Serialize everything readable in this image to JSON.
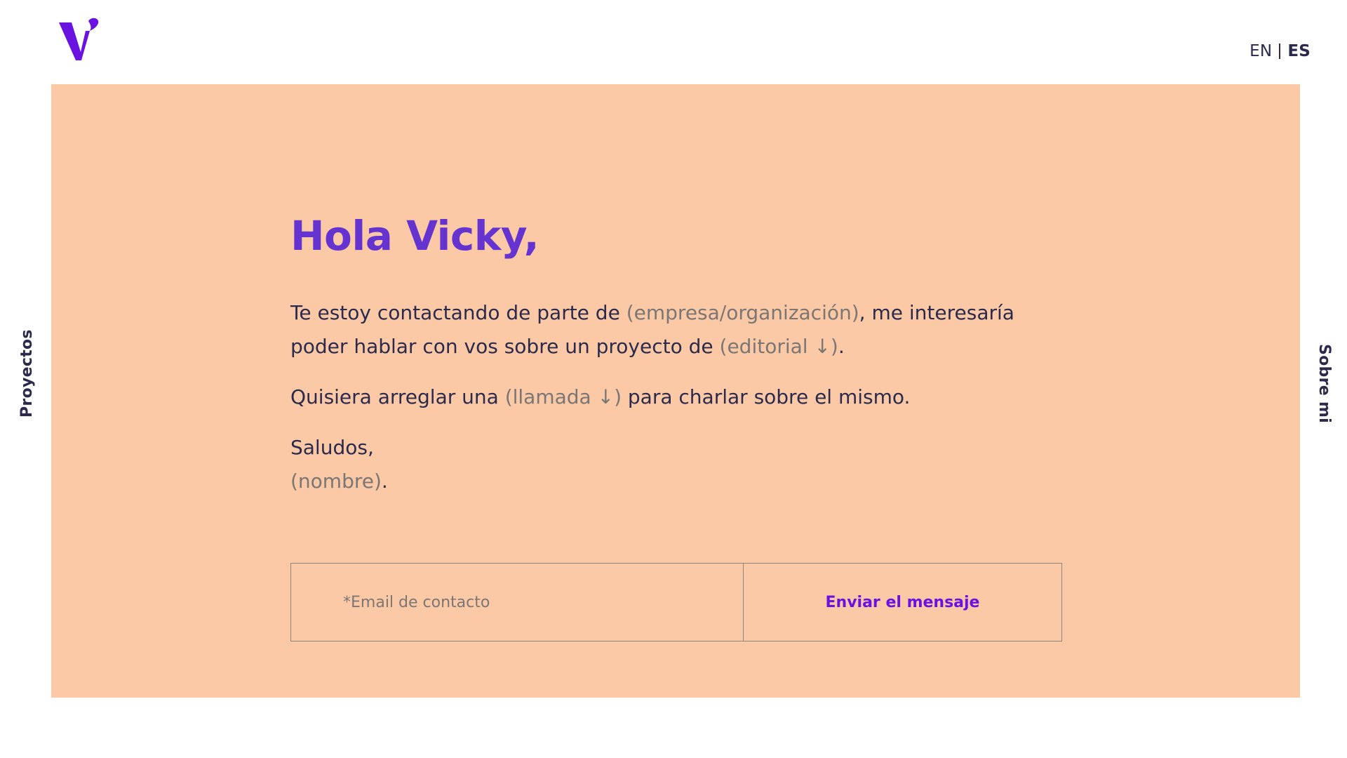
{
  "header": {
    "logo_name": "v-logo-icon",
    "lang_en": "EN",
    "lang_es": "ES"
  },
  "nav": {
    "left_label": "Proyectos",
    "right_label": "Sobre mi"
  },
  "message": {
    "greeting": "Hola Vicky,",
    "p1_a": "Te estoy contactando de parte de ",
    "company_placeholder": "(empresa/organización)",
    "p1_b": ", me interesaría poder hablar con vos sobre un proyecto de ",
    "project_type": "(editorial ↓)",
    "p1_c": ".",
    "p2_a": "Quisiera arreglar una ",
    "meeting_type": "(llamada ↓)",
    "p2_b": " para charlar sobre el mismo.",
    "closing": "Saludos,",
    "name_placeholder": "(nombre)",
    "name_end": "."
  },
  "form": {
    "email_placeholder": "*Email de contacto",
    "submit_label": "Enviar el mensaje"
  },
  "colors": {
    "card_bg": "#fbc9a6",
    "accent_purple": "#6533cf",
    "button_purple": "#6a12e0",
    "text_navy": "#2b2a4c",
    "placeholder_gray": "#7b7674"
  }
}
